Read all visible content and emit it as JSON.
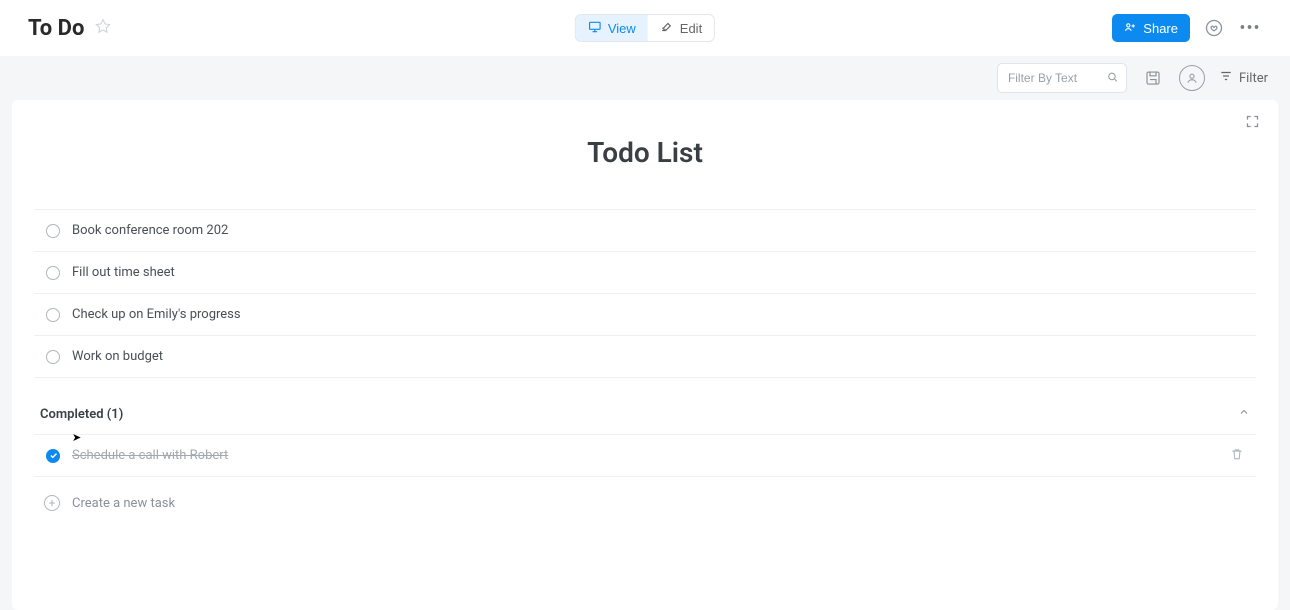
{
  "header": {
    "page_name": "To Do",
    "view_label": "View",
    "edit_label": "Edit",
    "share_label": "Share"
  },
  "toolbar": {
    "filter_placeholder": "Filter By Text",
    "filter_label": "Filter"
  },
  "list": {
    "title": "Todo List",
    "tasks": [
      {
        "label": "Book conference room 202"
      },
      {
        "label": "Fill out time sheet"
      },
      {
        "label": "Check up on Emily's progress"
      },
      {
        "label": "Work on budget"
      }
    ],
    "completed_header": "Completed (1)",
    "completed": [
      {
        "label": "Schedule a call with Robert"
      }
    ],
    "add_label": "Create a new task"
  }
}
